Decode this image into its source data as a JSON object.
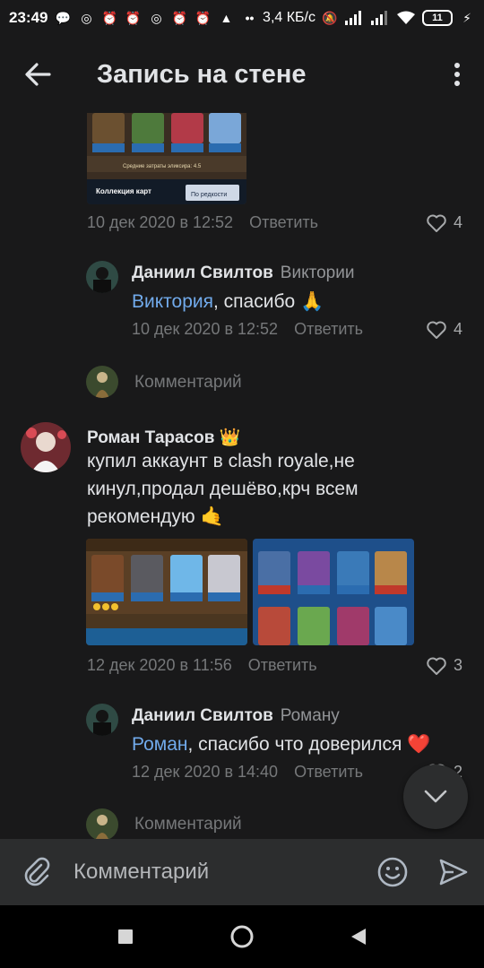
{
  "status_bar": {
    "time": "23:49",
    "speed": "3,4 КБ/с",
    "battery": "11"
  },
  "header": {
    "title": "Запись на стене"
  },
  "comment1": {
    "date": "10 дек 2020 в 12:52",
    "reply": "Ответить",
    "likes": "4"
  },
  "reply1": {
    "author": "Даниил Свилтов",
    "to": "Виктории",
    "mention": "Виктория",
    "text": ", спасибо 🙏",
    "date": "10 дек 2020 в 12:52",
    "reply": "Ответить",
    "likes": "4"
  },
  "comment_placeholder_1": "Комментарий",
  "comment2": {
    "author": "Роман Тарасов",
    "badge": "👑",
    "text_lines": [
      "купил аккаунт в clash royale,не",
      "кинул,продал дешёво,крч всем",
      "рекомендую 🤙"
    ],
    "date": "12 дек 2020 в 11:56",
    "reply": "Ответить",
    "likes": "3"
  },
  "reply2": {
    "author": "Даниил Свилтов",
    "to": "Роману",
    "mention": "Роман",
    "text": ", спасибо что доверился ❤️",
    "date": "12 дек 2020 в 14:40",
    "reply": "Ответить",
    "likes": "2"
  },
  "comment_placeholder_2": "Комментарий",
  "composer": {
    "placeholder": "Комментарий"
  },
  "top_image_text": {
    "line1": "Средние затраты эликсира: 4.5",
    "collection": "Коллекция карт",
    "sort": "По редкости"
  },
  "colors": {
    "background": "#19191a",
    "accent": "#71aaeb",
    "muted": "#76787a"
  }
}
